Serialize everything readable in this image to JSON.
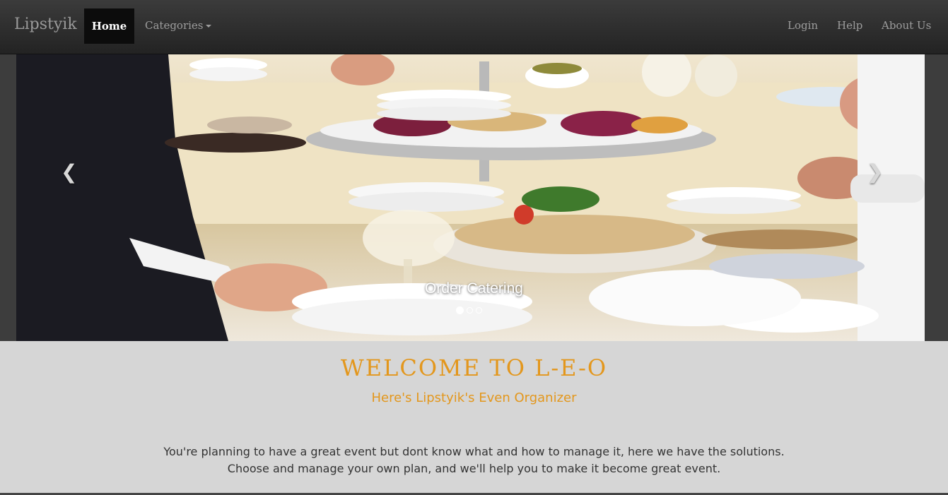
{
  "navbar": {
    "brand": "Lipstyik",
    "home_label": "Home",
    "categories_label": "Categories",
    "login_label": "Login",
    "help_label": "Help",
    "about_label": "About Us"
  },
  "carousel": {
    "caption": "Order Catering",
    "prev_icon": "chevron-left-icon",
    "next_icon": "chevron-right-icon",
    "indicator_count": 3,
    "active_index": 0
  },
  "welcome": {
    "title": "WELCOME TO L-E-O",
    "subtitle": "Here's Lipstyik's Even Organizer",
    "line1": "You're planning to have a great event but dont know what and how to manage it, here we have the solutions.",
    "line2": "Choose and manage your own plan, and we'll help you to make it become great event."
  },
  "colors": {
    "accent": "#e3971d",
    "navbar": "#2b2b2b",
    "page_bg": "#d6d6d6"
  }
}
